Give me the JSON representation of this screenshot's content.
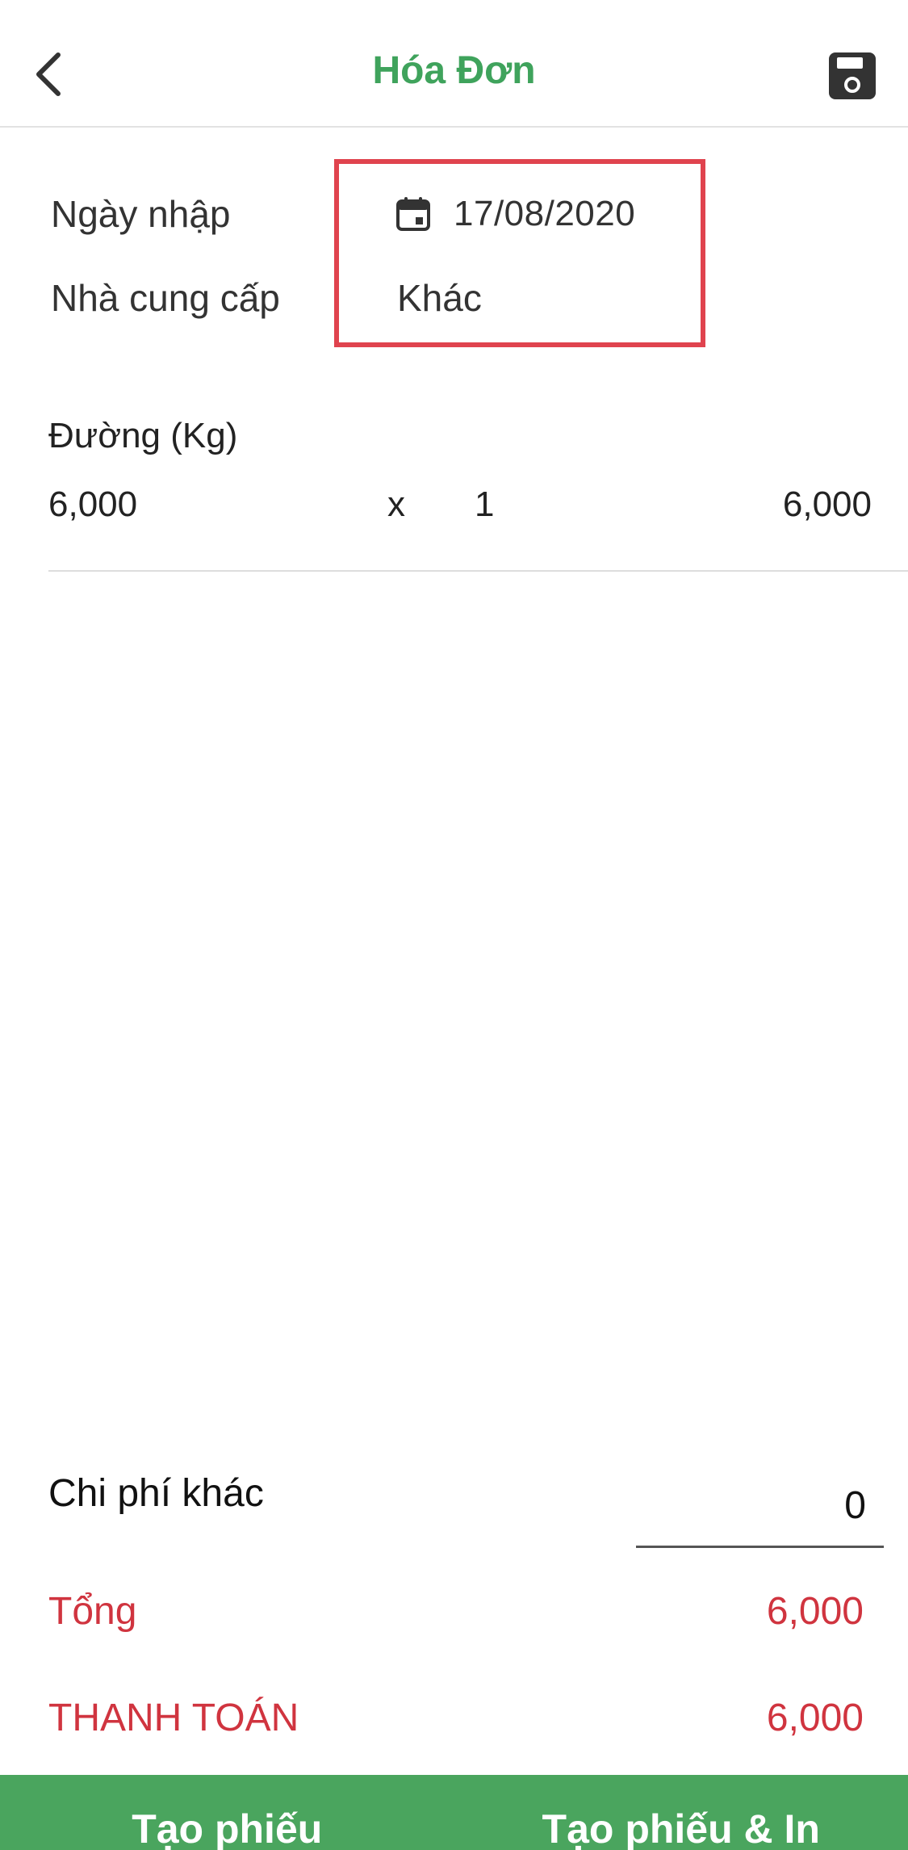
{
  "header": {
    "title": "Hóa Đơn",
    "back_icon": "chevron-left-icon",
    "save_icon": "floppy-disk-icon",
    "title_color": "#3fa35c"
  },
  "info": {
    "date_label": "Ngày nhập",
    "date_value": "17/08/2020",
    "date_icon": "calendar-icon",
    "supplier_label": "Nhà cung cấp",
    "supplier_value": "Khác",
    "highlight_color": "#e0434e"
  },
  "items": [
    {
      "name": "Đường (Kg)",
      "price": "6,000",
      "times": "x",
      "quantity": "1",
      "amount": "6,000"
    }
  ],
  "totals": {
    "other_cost_label": "Chi phí khác",
    "other_cost_value": "0",
    "total_label": "Tổng",
    "total_value": "6,000",
    "payment_label": "THANH TOÁN",
    "payment_value": "6,000",
    "total_color": "#d0343f"
  },
  "actions": {
    "create_label": "Tạo phiếu",
    "create_print_label": "Tạo phiếu & In",
    "bar_color": "#4aa55e"
  }
}
